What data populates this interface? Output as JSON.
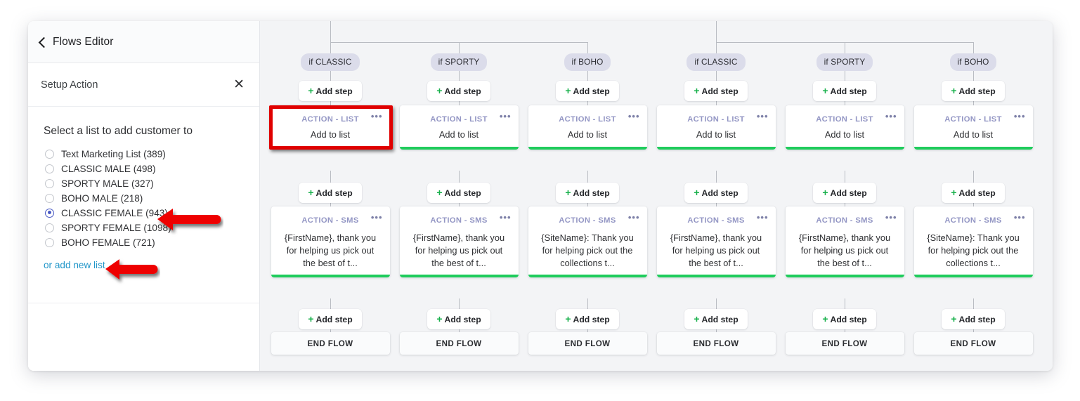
{
  "sidebar": {
    "back_label": "Flows Editor",
    "section_title": "Setup Action",
    "close_icon": "close-icon",
    "form_title": "Select a list to add customer to",
    "options": [
      {
        "label": "Text Marketing List (389)",
        "selected": false
      },
      {
        "label": "CLASSIC MALE (498)",
        "selected": false
      },
      {
        "label": "SPORTY MALE (327)",
        "selected": false
      },
      {
        "label": "BOHO MALE (218)",
        "selected": false
      },
      {
        "label": "CLASSIC FEMALE (943)",
        "selected": true
      },
      {
        "label": "SPORTY FEMALE (1098)",
        "selected": false
      },
      {
        "label": "BOHO FEMALE (721)",
        "selected": false
      }
    ],
    "add_new_link": "or add new list"
  },
  "canvas": {
    "add_step_label": "Add step",
    "end_flow_label": "END FLOW",
    "more_icon": "•••",
    "kind_list": "ACTION - LIST",
    "kind_sms": "ACTION - SMS",
    "columns": [
      {
        "branch": "if CLASSIC",
        "list_text": "Add to list",
        "list_complete": false,
        "sms_text": "{FirstName}, thank you for helping us pick out the best of t...",
        "sms_complete": true
      },
      {
        "branch": "if SPORTY",
        "list_text": "Add to list",
        "list_complete": true,
        "sms_text": "{FirstName}, thank you for helping us pick out the best of t...",
        "sms_complete": true
      },
      {
        "branch": "if BOHO",
        "list_text": "Add to list",
        "list_complete": true,
        "sms_text": "{SiteName}: Thank you for helping pick out the collections t...",
        "sms_complete": true
      },
      {
        "branch": "if CLASSIC",
        "list_text": "Add to list",
        "list_complete": true,
        "sms_text": "{FirstName}, thank you for helping us pick out the best of t...",
        "sms_complete": true
      },
      {
        "branch": "if SPORTY",
        "list_text": "Add to list",
        "list_complete": true,
        "sms_text": "{FirstName}, thank you for helping us pick out the best of t...",
        "sms_complete": true
      },
      {
        "branch": "if BOHO",
        "list_text": "Add to list",
        "list_complete": true,
        "sms_text": "{SiteName}: Thank you for helping pick out the collections t...",
        "sms_complete": true
      }
    ]
  },
  "annotations": {
    "highlight_color": "#e00000",
    "arrow_color": "#ee0000"
  }
}
